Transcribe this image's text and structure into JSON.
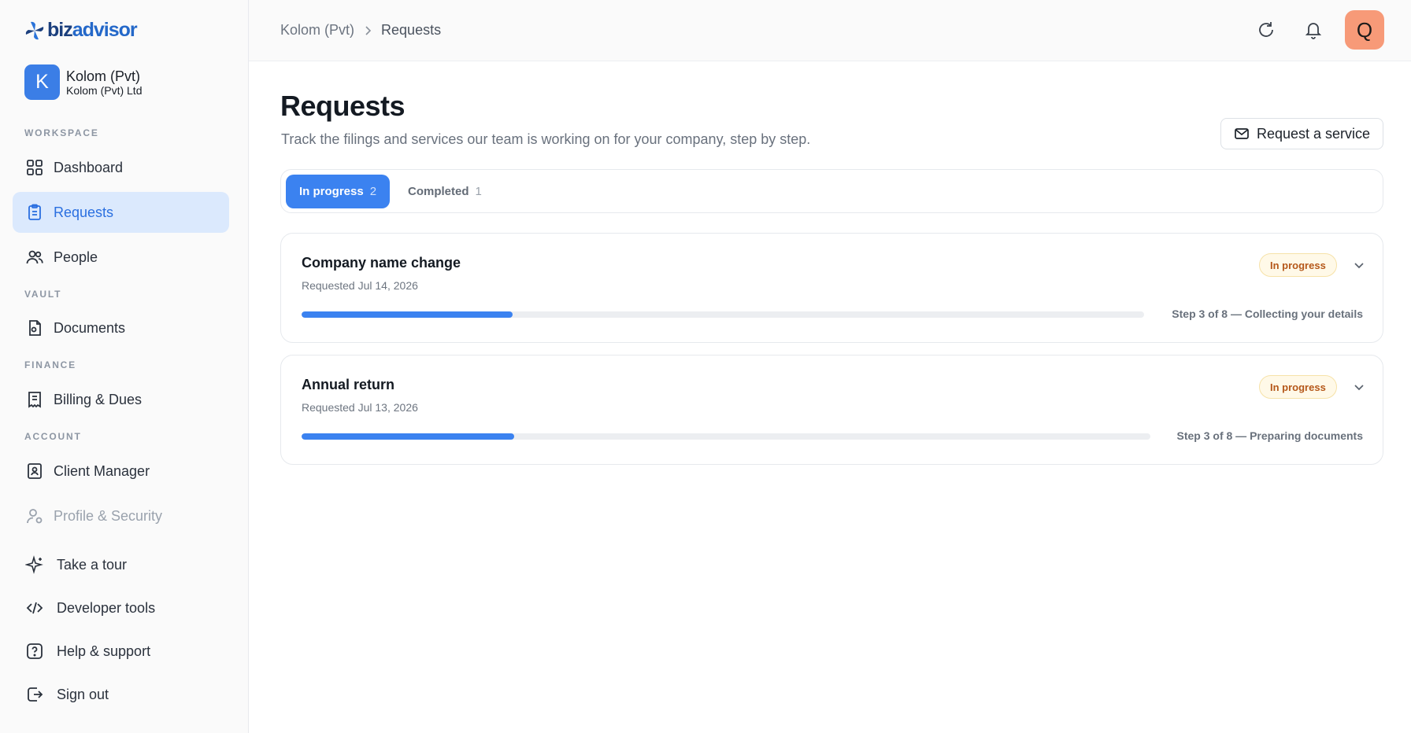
{
  "brand": {
    "name_prefix": "biz",
    "name_suffix": "advisor"
  },
  "company": {
    "initial": "K",
    "name": "Kolom (Pvt)",
    "legal_name": "Kolom (Pvt) Ltd"
  },
  "sidebar": {
    "sections": {
      "workspace": "WORKSPACE",
      "vault": "VAULT",
      "finance": "FINANCE",
      "account": "ACCOUNT"
    },
    "items": {
      "dashboard": "Dashboard",
      "requests": "Requests",
      "people": "People",
      "documents": "Documents",
      "billing": "Billing & Dues",
      "client_manager": "Client Manager",
      "profile_security": "Profile & Security"
    },
    "bottom": {
      "tour": "Take a tour",
      "developer": "Developer tools",
      "help": "Help & support",
      "signout": "Sign out"
    }
  },
  "topbar": {
    "breadcrumb": [
      "Kolom (Pvt)",
      "Requests"
    ],
    "user_initial": "Q",
    "icons": [
      "refresh-icon",
      "bell-icon"
    ]
  },
  "main": {
    "title": "Requests",
    "subtitle": "Track the filings and services our team is working on for your company, step by step.",
    "request_button": "Request a service",
    "tabs": [
      {
        "label": "In progress",
        "count": "2",
        "active": true
      },
      {
        "label": "Completed",
        "count": "1",
        "active": false
      }
    ],
    "requests": [
      {
        "title": "Company name change",
        "date": "Requested Jul 14, 2026",
        "status": "In progress",
        "step_text": "Step 3 of 8 — Collecting your details",
        "progress": 0.25
      },
      {
        "title": "Annual return",
        "date": "Requested Jul 13, 2026",
        "status": "In progress",
        "step_text": "Step 3 of 8 — Preparing documents",
        "progress": 0.25
      }
    ]
  },
  "colors": {
    "accent": "#3b82f0",
    "active_nav_bg": "#dbe9fd",
    "avatar_company": "#3b7ee6",
    "avatar_user": "#f79a78",
    "badge_text": "#b5581a",
    "badge_bg": "#fff9e8"
  }
}
